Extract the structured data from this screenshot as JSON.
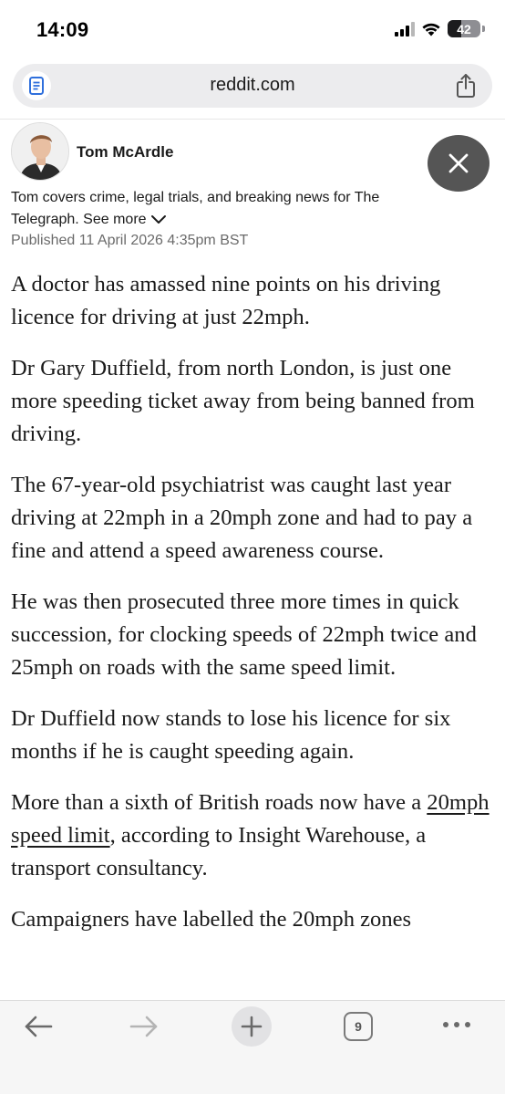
{
  "status_bar": {
    "time": "14:09",
    "battery_percent": "42",
    "battery_level": 0.42,
    "icons": [
      "cellular-signal-icon",
      "wifi-icon",
      "battery-icon"
    ]
  },
  "browser": {
    "url": "reddit.com",
    "icons": [
      "page-document-icon",
      "share-icon"
    ]
  },
  "author": {
    "name": "Tom McArdle",
    "bio": "Tom covers crime, legal trials, and breaking news for The Telegraph.",
    "see_more": "See more",
    "published": "Published 11 April 2026 4:35pm BST"
  },
  "article": {
    "p1": "A doctor has amassed nine points on his driving licence for driving at just 22mph.",
    "p2": "Dr Gary Duffield, from north London, is just one more speeding ticket away from being banned from driving.",
    "p3": "The 67-year-old psychiatrist was caught last year driving at 22mph in a 20mph zone and had to pay a fine and attend a speed awareness course.",
    "p4": "He was then prosecuted three more times in quick succession, for clocking speeds of 22mph twice and 25mph on roads with the same speed limit.",
    "p5": "Dr Duffield now stands to lose his licence for six months if he is caught speeding again.",
    "p6_before": "More than a sixth of British roads now have a ",
    "p6_link": "20mph speed limit",
    "p6_after": ", according to Insight Warehouse, a transport consultancy.",
    "p7_partial": "Campaigners have labelled the 20mph zones"
  },
  "toolbar": {
    "tab_count": "9",
    "icons": [
      "back-arrow-icon",
      "forward-arrow-icon",
      "plus-icon",
      "tabs-icon",
      "more-dots-icon"
    ]
  },
  "colors": {
    "close_button": "#555555",
    "url_bar": "#ececee",
    "toolbar": "#f6f6f6",
    "text": "#1a1a1a",
    "muted": "#6b6b6b"
  }
}
